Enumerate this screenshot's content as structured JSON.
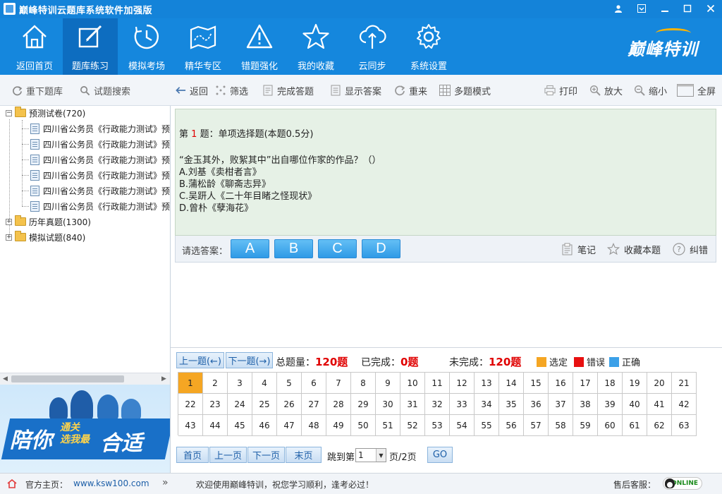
{
  "window": {
    "title": "巅峰特训云题库系统软件加强版",
    "controls": [
      "user-icon",
      "menu-icon",
      "minimize-icon",
      "close-icon"
    ]
  },
  "nav": {
    "items": [
      {
        "label": "返回首页",
        "icon": "home-icon"
      },
      {
        "label": "题库练习",
        "icon": "edit-icon",
        "active": true
      },
      {
        "label": "模拟考场",
        "icon": "clock-icon"
      },
      {
        "label": "精华专区",
        "icon": "map-icon"
      },
      {
        "label": "错题强化",
        "icon": "warning-icon"
      },
      {
        "label": "我的收藏",
        "icon": "star-icon"
      },
      {
        "label": "云同步",
        "icon": "cloud-sync-icon"
      },
      {
        "label": "系统设置",
        "icon": "gear-icon"
      }
    ],
    "brand": "巅峰特训"
  },
  "left_toolbar": {
    "reload": "重下题库",
    "search": "试题搜索"
  },
  "tree": {
    "root": {
      "label": "预测试卷(720)"
    },
    "children": [
      "四川省公务员《行政能力测试》预",
      "四川省公务员《行政能力测试》预",
      "四川省公务员《行政能力测试》预",
      "四川省公务员《行政能力测试》预",
      "四川省公务员《行政能力测试》预",
      "四川省公务员《行政能力测试》预"
    ],
    "others": [
      {
        "label": "历年真题(1300)"
      },
      {
        "label": "模拟试题(840)"
      }
    ]
  },
  "banner": {
    "t1": "陪你",
    "t2a": "通关",
    "t2b": "选我最",
    "t3": "合适"
  },
  "right_toolbar": {
    "back": "返回",
    "filter": "筛选",
    "finish": "完成答题",
    "show_answer": "显示答案",
    "redo": "重来",
    "multi_mode": "多题模式",
    "print": "打印",
    "zoom_in": "放大",
    "zoom_out": "缩小",
    "fullscreen": "全屏"
  },
  "question": {
    "prefix": "第",
    "number": "1",
    "suffix": "题：单项选择题(本题0.5分)",
    "stem": "“金玉其外，败絮其中”出自哪位作家的作品？（）",
    "options": [
      "A.刘基《卖柑者言》",
      "B.蒲松龄《聊斋志异》",
      "C.吴趼人《二十年目睹之怪现状》",
      "D.曾朴《孽海花》"
    ]
  },
  "answer_bar": {
    "label": "请选答案：",
    "choices": [
      "A",
      "B",
      "C",
      "D"
    ],
    "note": "笔记",
    "favorite": "收藏本题",
    "report": "纠错"
  },
  "nav_controls": {
    "prev": "上一题(←)",
    "next": "下一题(→)",
    "total_label": "总题量：",
    "total_value": "120题",
    "done_label": "已完成：",
    "done_value": "0题",
    "undone_label": "未完成：",
    "undone_value": "120题"
  },
  "legend": [
    {
      "label": "选定",
      "color": "#f5a623"
    },
    {
      "label": "错误",
      "color": "#e81010"
    },
    {
      "label": "正确",
      "color": "#3ba0e8"
    }
  ],
  "grid": {
    "selected": 1,
    "numbers": [
      1,
      2,
      3,
      4,
      5,
      6,
      7,
      8,
      9,
      10,
      11,
      12,
      13,
      14,
      15,
      16,
      17,
      18,
      19,
      20,
      21,
      22,
      23,
      24,
      25,
      26,
      27,
      28,
      29,
      30,
      31,
      32,
      33,
      34,
      35,
      36,
      37,
      38,
      39,
      40,
      41,
      42,
      43,
      44,
      45,
      46,
      47,
      48,
      49,
      50,
      51,
      52,
      53,
      54,
      55,
      56,
      57,
      58,
      59,
      60,
      61,
      62,
      63
    ]
  },
  "pager": {
    "first": "首页",
    "prev": "上一页",
    "next": "下一页",
    "last": "末页",
    "jump_label": "跳到第",
    "current": "1",
    "total": "页/2页",
    "go": "GO"
  },
  "status": {
    "home_label": "官方主页：",
    "home_url": "www.ksw100.com",
    "arrows": "»",
    "welcome": "欢迎使用巅峰特训，祝您学习顺利，逢考必过！",
    "service": "售后客服：",
    "online": "ONLINE"
  }
}
